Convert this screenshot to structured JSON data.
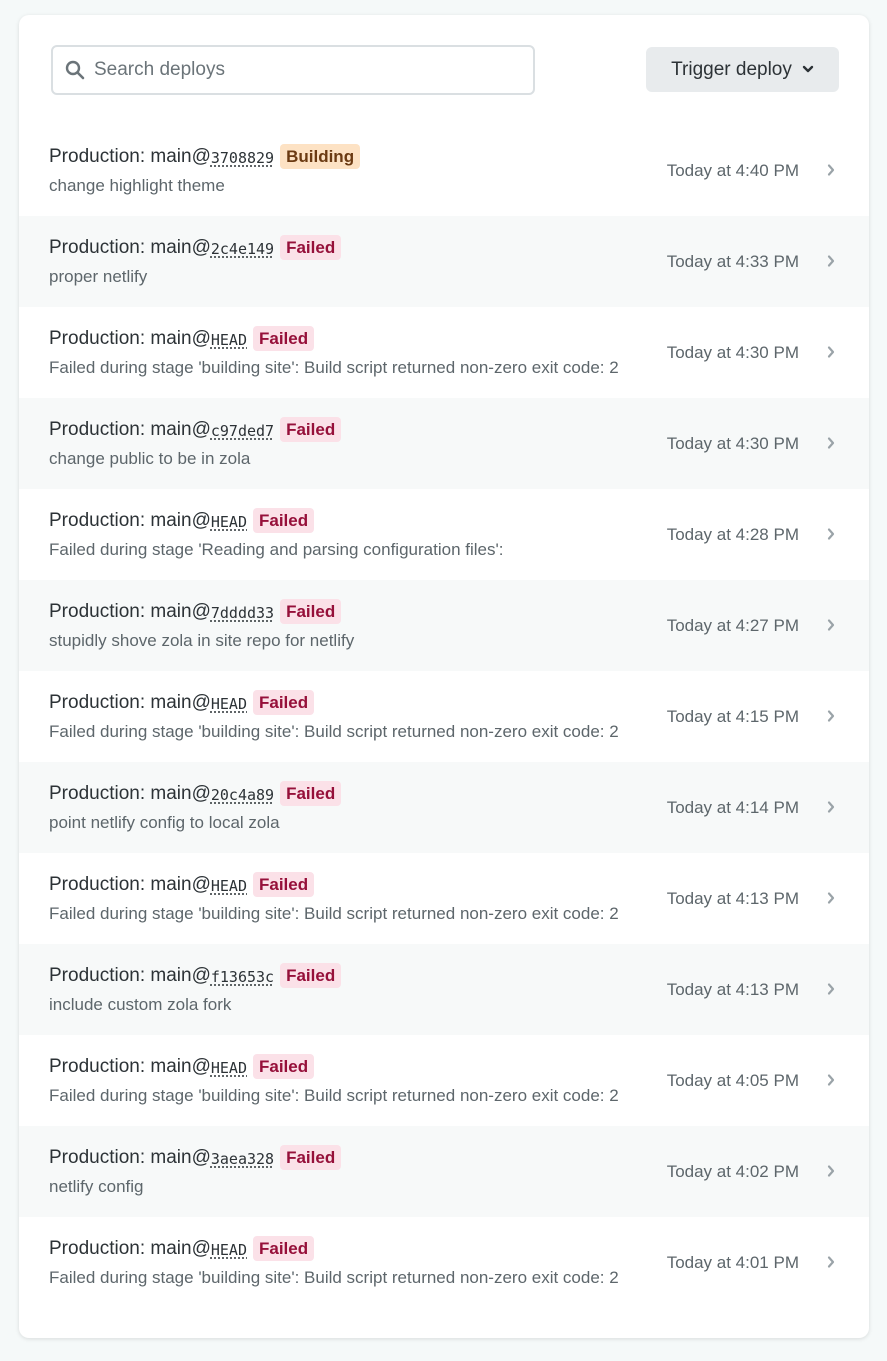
{
  "search": {
    "placeholder": "Search deploys",
    "value": ""
  },
  "toolbar": {
    "trigger_label": "Trigger deploy"
  },
  "colors": {
    "failed_bg": "#fbe1e8",
    "failed_text": "#96103a",
    "building_bg": "#fde2c4",
    "building_text": "#6b3a12"
  },
  "deploys": [
    {
      "context": "Production: main@",
      "ref": "3708829",
      "status": "Building",
      "message": "change highlight theme",
      "time": "Today at 4:40 PM"
    },
    {
      "context": "Production: main@",
      "ref": "2c4e149",
      "status": "Failed",
      "message": "proper netlify",
      "time": "Today at 4:33 PM"
    },
    {
      "context": "Production: main@",
      "ref": "HEAD",
      "status": "Failed",
      "message": "Failed during stage 'building site': Build script returned non-zero exit code: 2",
      "time": "Today at 4:30 PM"
    },
    {
      "context": "Production: main@",
      "ref": "c97ded7",
      "status": "Failed",
      "message": "change public to be in zola",
      "time": "Today at 4:30 PM"
    },
    {
      "context": "Production: main@",
      "ref": "HEAD",
      "status": "Failed",
      "message": "Failed during stage 'Reading and parsing configuration files':",
      "time": "Today at 4:28 PM"
    },
    {
      "context": "Production: main@",
      "ref": "7dddd33",
      "status": "Failed",
      "message": "stupidly shove zola in site repo for netlify",
      "time": "Today at 4:27 PM"
    },
    {
      "context": "Production: main@",
      "ref": "HEAD",
      "status": "Failed",
      "message": "Failed during stage 'building site': Build script returned non-zero exit code: 2",
      "time": "Today at 4:15 PM"
    },
    {
      "context": "Production: main@",
      "ref": "20c4a89",
      "status": "Failed",
      "message": "point netlify config to local zola",
      "time": "Today at 4:14 PM"
    },
    {
      "context": "Production: main@",
      "ref": "HEAD",
      "status": "Failed",
      "message": "Failed during stage 'building site': Build script returned non-zero exit code: 2",
      "time": "Today at 4:13 PM"
    },
    {
      "context": "Production: main@",
      "ref": "f13653c",
      "status": "Failed",
      "message": "include custom zola fork",
      "time": "Today at 4:13 PM"
    },
    {
      "context": "Production: main@",
      "ref": "HEAD",
      "status": "Failed",
      "message": "Failed during stage 'building site': Build script returned non-zero exit code: 2",
      "time": "Today at 4:05 PM"
    },
    {
      "context": "Production: main@",
      "ref": "3aea328",
      "status": "Failed",
      "message": "netlify config",
      "time": "Today at 4:02 PM"
    },
    {
      "context": "Production: main@",
      "ref": "HEAD",
      "status": "Failed",
      "message": "Failed during stage 'building site': Build script returned non-zero exit code: 2",
      "time": "Today at 4:01 PM"
    }
  ]
}
